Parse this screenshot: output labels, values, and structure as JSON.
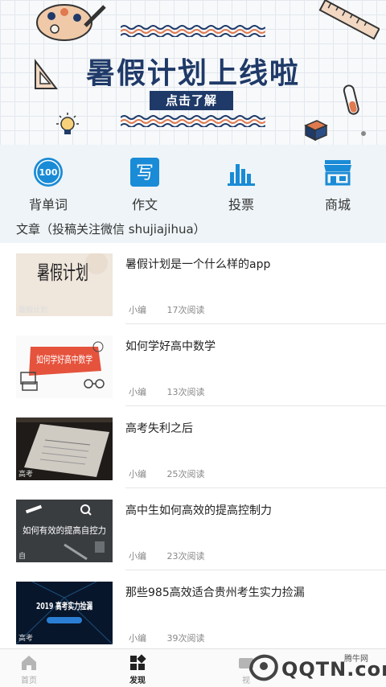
{
  "banner": {
    "title": "暑假计划上线啦",
    "button_label": "点击了解"
  },
  "quick_nav": [
    {
      "label": "背单词",
      "icon": "badge-100-icon",
      "icon_text": "100"
    },
    {
      "label": "作文",
      "icon": "write-icon",
      "icon_text": "写"
    },
    {
      "label": "投票",
      "icon": "bar-chart-icon",
      "icon_text": ""
    },
    {
      "label": "商城",
      "icon": "store-icon",
      "icon_text": ""
    }
  ],
  "section": {
    "title": "文章（投稿关注微信 shujiajihua）"
  },
  "articles": [
    {
      "title": "暑假计划是一个什么样的app",
      "author": "小编",
      "reads": "17次阅读",
      "thumb_text": "暑假计划",
      "thumb_caption": "暑假计划"
    },
    {
      "title": "如何学好高中数学",
      "author": "小编",
      "reads": "13次阅读",
      "thumb_text": "如何学好高中数学",
      "thumb_caption": ""
    },
    {
      "title": "高考失利之后",
      "author": "小编",
      "reads": "25次阅读",
      "thumb_text": "",
      "thumb_caption": "高考"
    },
    {
      "title": "高中生如何高效的提高控制力",
      "author": "小编",
      "reads": "23次阅读",
      "thumb_text": "如何有效的提高自控力",
      "thumb_caption": "自"
    },
    {
      "title": "那些985高效适合贵州考生实力捡漏",
      "author": "小编",
      "reads": "39次阅读",
      "thumb_text": "2019 高考实力捡漏",
      "thumb_caption": "高考"
    }
  ],
  "tabbar": [
    {
      "label": "首页",
      "icon": "home-icon",
      "active": false
    },
    {
      "label": "发现",
      "icon": "grid-icon",
      "active": true
    },
    {
      "label": "视",
      "icon": "video-icon",
      "active": false
    }
  ],
  "watermark": {
    "main": "QQTN.com",
    "sub": "腾牛网"
  },
  "colors": {
    "banner_navy": "#1f3a68",
    "nav_bg": "#eef4f7",
    "wave_blue": "#1f3a68",
    "wave_orange": "#e07a4f",
    "accent_blue": "#1a8bd6"
  }
}
